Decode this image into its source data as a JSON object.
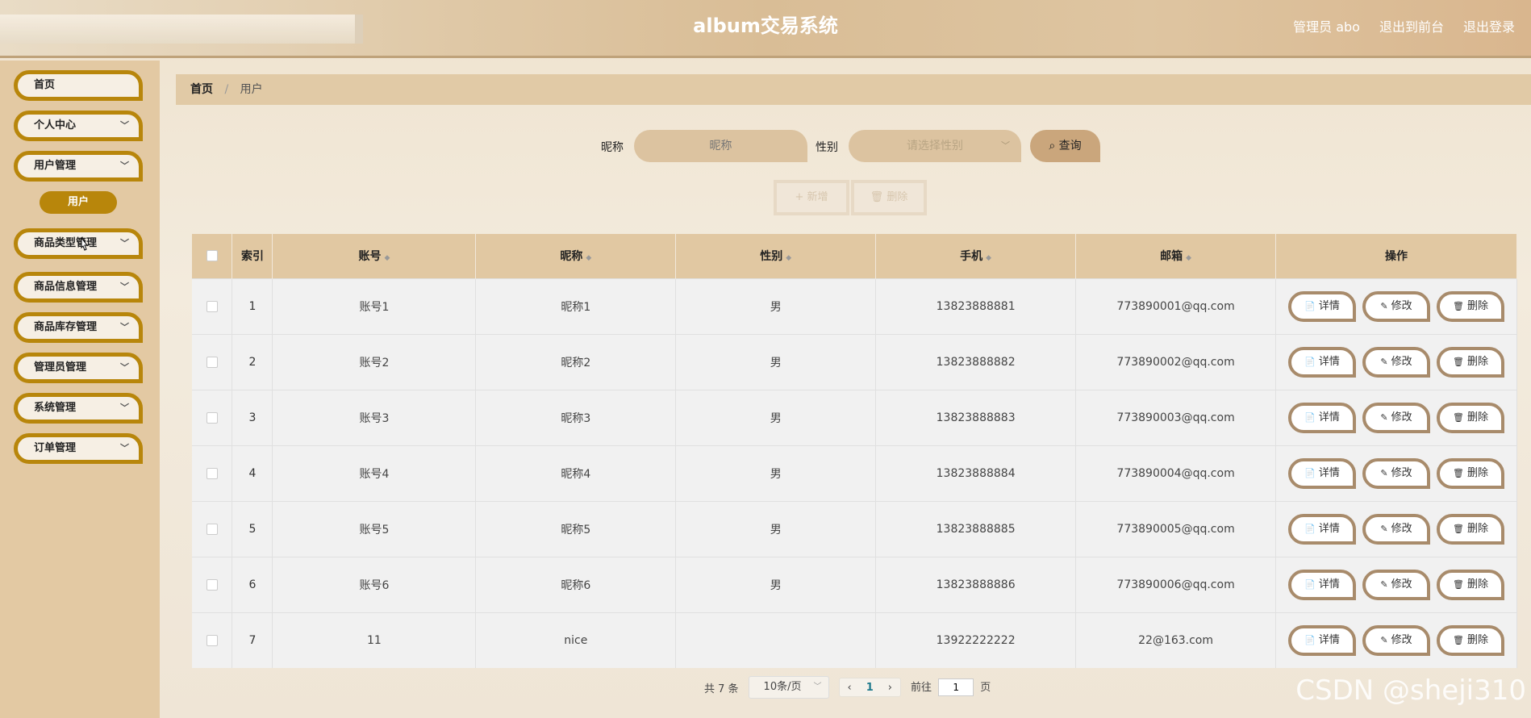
{
  "header": {
    "title": "album交易系统",
    "user": "管理员 abo",
    "front_link": "退出到前台",
    "logout": "退出登录"
  },
  "sidebar": {
    "items": [
      {
        "label": "首页",
        "has_chevron": false
      },
      {
        "label": "个人中心",
        "has_chevron": true
      },
      {
        "label": "用户管理",
        "has_chevron": true
      },
      {
        "label": "商品类型管理",
        "has_chevron": true
      },
      {
        "label": "商品信息管理",
        "has_chevron": true
      },
      {
        "label": "商品库存管理",
        "has_chevron": true
      },
      {
        "label": "管理员管理",
        "has_chevron": true
      },
      {
        "label": "系统管理",
        "has_chevron": true
      },
      {
        "label": "订单管理",
        "has_chevron": true
      }
    ],
    "active_sub": "用户"
  },
  "breadcrumb": {
    "home": "首页",
    "separator": "/",
    "current": "用户"
  },
  "search": {
    "nickname_label": "昵称",
    "nickname_placeholder": "昵称",
    "gender_label": "性别",
    "gender_placeholder": "请选择性别",
    "query_label": "查询"
  },
  "actions": {
    "add_label": "+ 新增",
    "delete_label": "删除"
  },
  "table": {
    "headers": [
      "索引",
      "账号",
      "昵称",
      "性别",
      "手机",
      "邮箱",
      "操作"
    ],
    "rows": [
      [
        "1",
        "账号1",
        "昵称1",
        "男",
        "13823888881",
        "773890001@qq.com"
      ],
      [
        "2",
        "账号2",
        "昵称2",
        "男",
        "13823888882",
        "773890002@qq.com"
      ],
      [
        "3",
        "账号3",
        "昵称3",
        "男",
        "13823888883",
        "773890003@qq.com"
      ],
      [
        "4",
        "账号4",
        "昵称4",
        "男",
        "13823888884",
        "773890004@qq.com"
      ],
      [
        "5",
        "账号5",
        "昵称5",
        "男",
        "13823888885",
        "773890005@qq.com"
      ],
      [
        "6",
        "账号6",
        "昵称6",
        "男",
        "13823888886",
        "773890006@qq.com"
      ],
      [
        "7",
        "11",
        "nice",
        "",
        "13922222222",
        "22@163.com"
      ]
    ],
    "row_actions": [
      "详情",
      "修改",
      "删除"
    ]
  },
  "pagination": {
    "total": "共 7 条",
    "page_size": "10条/页",
    "current_page": "1",
    "goto_label": "前往",
    "goto_value": "1",
    "page_suffix": "页"
  },
  "watermark": "CSDN @sheji310",
  "colors": {
    "accent": "#b8860b",
    "header": "#d9bd96",
    "table_header": "#e1c8a2"
  }
}
